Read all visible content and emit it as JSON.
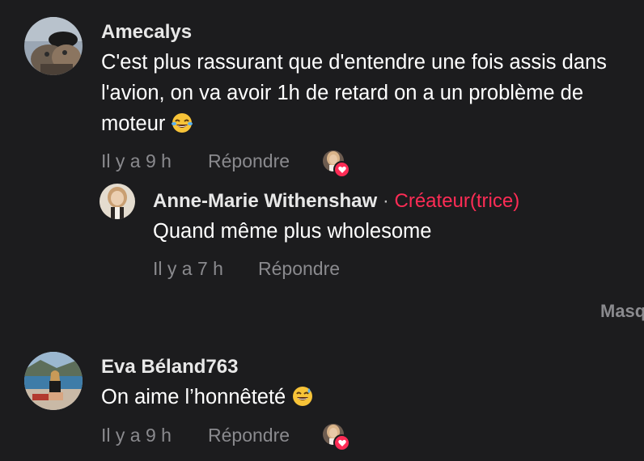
{
  "comments": [
    {
      "username": "Amecalys",
      "text": "C'est plus rassurant que d'entendre une fois assis dans l'avion, on va avoir 1h de retard on a un problème de moteur",
      "emoji": "😂",
      "time": "Il y a 9 h",
      "reply_label": "Répondre"
    },
    {
      "username": "Eva Béland763",
      "text": "On aime l’honnêteté",
      "emoji": "😅",
      "time": "Il y a 9 h",
      "reply_label": "Répondre"
    }
  ],
  "reply": {
    "username": "Anne-Marie Withenshaw",
    "separator": "·",
    "creator_tag": "Créateur(trice)",
    "text": "Quand même plus wholesome",
    "time": "Il y a 7 h",
    "reply_label": "Répondre"
  },
  "hide_replies_label": "Masquer",
  "colors": {
    "background": "#1c1c1e",
    "accent": "#fe2c55",
    "muted": "#8a8a8e"
  },
  "icons": {
    "creator_like": "heart-icon",
    "emoji_laugh": "face-with-tears-of-joy",
    "emoji_sweat": "grinning-face-with-sweat"
  }
}
